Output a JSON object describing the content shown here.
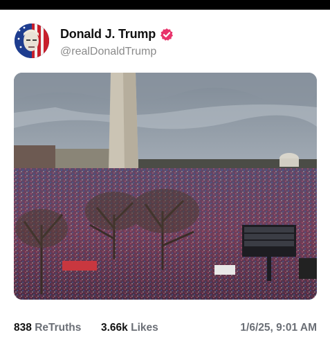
{
  "post": {
    "author": {
      "display_name": "Donald J. Trump",
      "handle": "@realDonaldTrump",
      "verified": true,
      "verified_color": "#e8336b"
    },
    "media": {
      "kind": "photo",
      "icon": "crowd-photo"
    },
    "stats": {
      "retruths_count": "838",
      "retruths_label": "ReTruths",
      "likes_count": "3.66k",
      "likes_label": "Likes"
    },
    "timestamp": "1/6/25, 9:01 AM"
  }
}
